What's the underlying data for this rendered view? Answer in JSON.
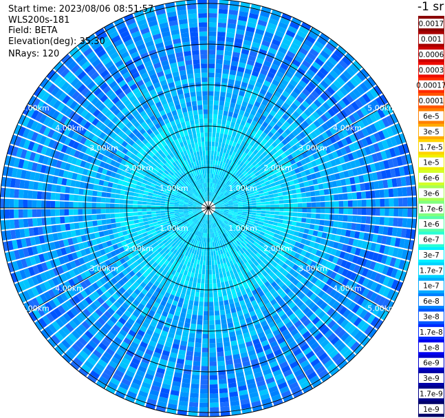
{
  "header": {
    "start_time": "Start time: 2023/08/06 08:51:57",
    "instrument": "WLS200s-181",
    "field": "Field: BETA",
    "elevation": "Elevation(deg): 35.30",
    "nrays": "NRays: 120"
  },
  "colorbar": {
    "unit_label": "-1 sr",
    "ticks": [
      "0.0017",
      "0.001",
      "0.0006",
      "0.0003",
      "0.00017",
      "0.0001",
      "6e-5",
      "3e-5",
      "1.7e-5",
      "1e-5",
      "6e-6",
      "3e-6",
      "1.7e-6",
      "1e-6",
      "6e-7",
      "3e-7",
      "1.7e-7",
      "1e-7",
      "6e-8",
      "3e-8",
      "1.7e-8",
      "1e-8",
      "6e-9",
      "3e-9",
      "1.7e-9",
      "1e-9"
    ],
    "colors": [
      "#8a0000",
      "#a80000",
      "#cc0000",
      "#ee0a00",
      "#ff2a00",
      "#ff5500",
      "#ff8000",
      "#ffaa00",
      "#ffd400",
      "#f0f000",
      "#d4ff28",
      "#a8ff55",
      "#80ff80",
      "#55ffaa",
      "#2affd4",
      "#00f0ff",
      "#00d4ff",
      "#00aaff",
      "#0080ff",
      "#0055ff",
      "#002aff",
      "#0000f0",
      "#0000cc",
      "#0000a8",
      "#000088",
      "#00006a"
    ]
  },
  "chart_data": {
    "type": "heatmap",
    "projection": "polar PPI",
    "nrays": 120,
    "range_rings_km": [
      "1.00km",
      "2.00km",
      "3.00km",
      "4.00km",
      "5.00km"
    ],
    "max_range_km": 5.0,
    "dominant_value_range": [
      "1e-8",
      "1.7e-7"
    ],
    "grid": true
  }
}
